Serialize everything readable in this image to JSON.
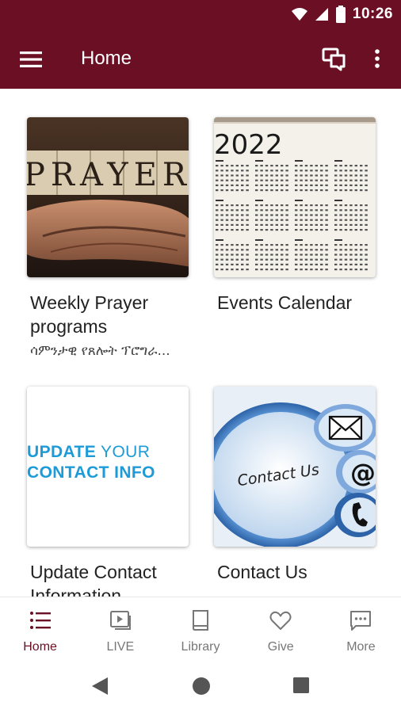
{
  "status_bar": {
    "time": "10:26"
  },
  "app_bar": {
    "title": "Home"
  },
  "cards": [
    {
      "title": "Weekly Prayer programs",
      "subtitle": "ሳምንታዊ የጸሎት ፕሮግራ...",
      "image_text": "PRAYER"
    },
    {
      "title": "Events Calendar",
      "image_text": "2022"
    },
    {
      "title": "Update Contact Information",
      "image_text_line1_bold": "UPDATE",
      "image_text_line1_light": " YOUR",
      "image_text_line2": "CONTACT INFO"
    },
    {
      "title": "Contact Us",
      "image_text": "Contact Us"
    }
  ],
  "bottom_nav": [
    {
      "label": "Home",
      "icon": "list-icon",
      "active": true
    },
    {
      "label": "LIVE",
      "icon": "live-video-icon"
    },
    {
      "label": "Library",
      "icon": "book-icon"
    },
    {
      "label": "Give",
      "icon": "heart-icon"
    },
    {
      "label": "More",
      "icon": "chat-dots-icon"
    }
  ],
  "colors": {
    "primary": "#6b0f24",
    "accent_blue": "#1e9bd7"
  }
}
